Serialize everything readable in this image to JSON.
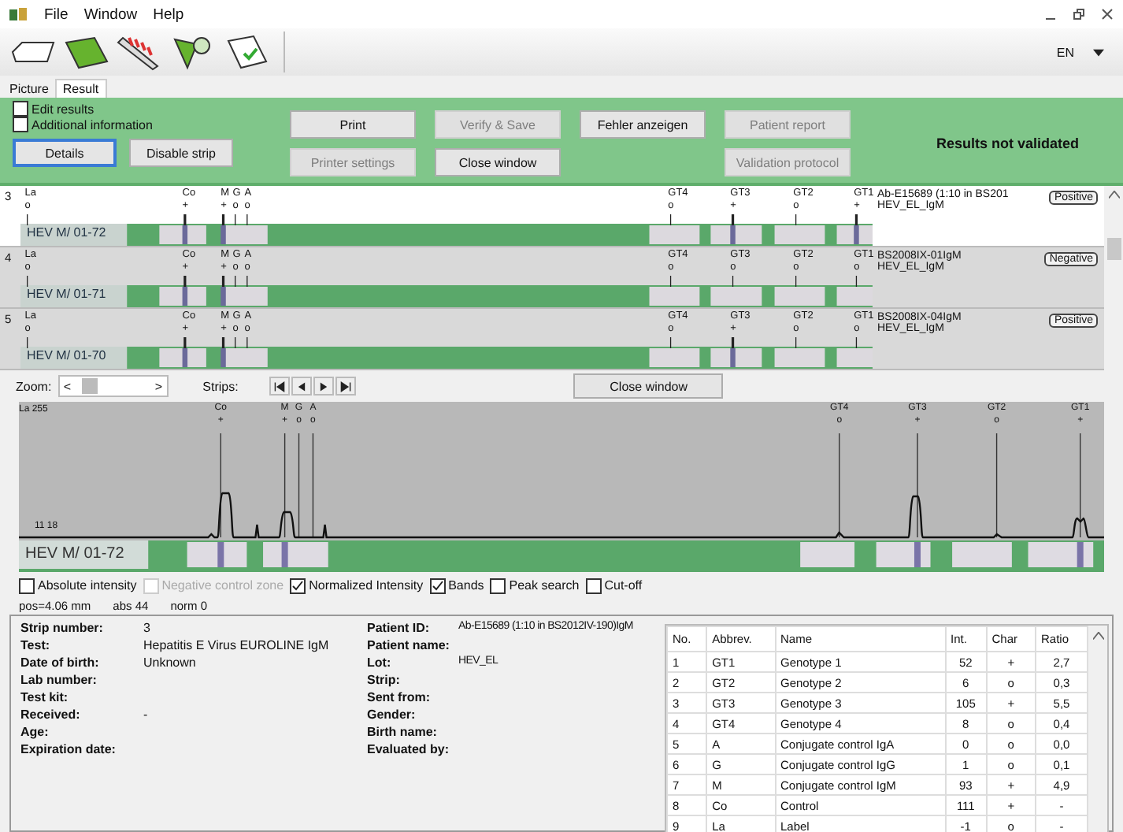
{
  "window": {
    "menu": [
      "File",
      "Window",
      "Help"
    ],
    "language": "EN"
  },
  "tabs": [
    {
      "label": "Picture",
      "selected": false
    },
    {
      "label": "Result",
      "selected": true
    }
  ],
  "options": [
    {
      "label": "Edit results",
      "checked": false
    },
    {
      "label": "Additional information",
      "checked": false
    }
  ],
  "left_buttons": [
    {
      "label": "Details",
      "disabled": false,
      "focused": true
    },
    {
      "label": "Disable strip",
      "disabled": false,
      "focused": false
    }
  ],
  "action_columns": [
    [
      {
        "label": "Print",
        "disabled": false
      },
      {
        "label": "Printer settings",
        "disabled": true
      }
    ],
    [
      {
        "label": "Verify & Save",
        "disabled": true
      },
      {
        "label": "Close window",
        "disabled": false
      }
    ],
    [
      {
        "label": "Fehler anzeigen",
        "disabled": false
      }
    ],
    [
      {
        "label": "Patient report",
        "disabled": true
      },
      {
        "label": "Validation protocol",
        "disabled": true
      }
    ]
  ],
  "validation_status": "Results not validated",
  "strips": [
    {
      "number": "3",
      "label": "HEV M/ 01-72",
      "patient": "Ab-E15689 (1:10 in BS201",
      "lot": "HEV_EL_IgM",
      "result": "Positive",
      "selected": true,
      "bands": [
        {
          "name": "La",
          "mark": "o"
        },
        {
          "name": "Co",
          "mark": "+"
        },
        {
          "name": "M",
          "mark": "+"
        },
        {
          "name": "G",
          "mark": "o"
        },
        {
          "name": "A",
          "mark": "o"
        },
        {
          "name": "GT4",
          "mark": "o"
        },
        {
          "name": "GT3",
          "mark": "+"
        },
        {
          "name": "GT2",
          "mark": "o"
        },
        {
          "name": "GT1",
          "mark": "+"
        }
      ]
    },
    {
      "number": "4",
      "label": "HEV M/ 01-71",
      "patient": "BS2008IX-01IgM",
      "lot": "HEV_EL_IgM",
      "result": "Negative",
      "selected": false,
      "bands": [
        {
          "name": "La",
          "mark": "o"
        },
        {
          "name": "Co",
          "mark": "+"
        },
        {
          "name": "M",
          "mark": "+"
        },
        {
          "name": "G",
          "mark": "o"
        },
        {
          "name": "A",
          "mark": "o"
        },
        {
          "name": "GT4",
          "mark": "o"
        },
        {
          "name": "GT3",
          "mark": "o"
        },
        {
          "name": "GT2",
          "mark": "o"
        },
        {
          "name": "GT1",
          "mark": "o"
        }
      ]
    },
    {
      "number": "5",
      "label": "HEV M/ 01-70",
      "patient": "BS2008IX-04IgM",
      "lot": "HEV_EL_IgM",
      "result": "Positive",
      "selected": false,
      "bands": [
        {
          "name": "La",
          "mark": "o"
        },
        {
          "name": "Co",
          "mark": "+"
        },
        {
          "name": "M",
          "mark": "+"
        },
        {
          "name": "G",
          "mark": "o"
        },
        {
          "name": "A",
          "mark": "o"
        },
        {
          "name": "GT4",
          "mark": "o"
        },
        {
          "name": "GT3",
          "mark": "+"
        },
        {
          "name": "GT2",
          "mark": "o"
        },
        {
          "name": "GT1",
          "mark": "o"
        }
      ]
    }
  ],
  "zoom": {
    "label": "Zoom:",
    "left": "<",
    "right": ">"
  },
  "strip_nav": {
    "label": "Strips:"
  },
  "close_window_button": "Close window",
  "graph": {
    "scale_label": "La 255",
    "baseline_label": "11 18",
    "strip_label": "HEV M/ 01-72",
    "bands": [
      {
        "name": "Co",
        "mark": "+"
      },
      {
        "name": "M",
        "mark": "+"
      },
      {
        "name": "G",
        "mark": "o"
      },
      {
        "name": "A",
        "mark": "o"
      },
      {
        "name": "GT4",
        "mark": "o"
      },
      {
        "name": "GT3",
        "mark": "+"
      },
      {
        "name": "GT2",
        "mark": "o"
      },
      {
        "name": "GT1",
        "mark": "+"
      }
    ]
  },
  "view_options": [
    {
      "label": "Absolute intensity",
      "checked": false,
      "disabled": false
    },
    {
      "label": "Negative control zone",
      "checked": false,
      "disabled": true
    },
    {
      "label": "Normalized Intensity",
      "checked": true,
      "disabled": false
    },
    {
      "label": "Bands",
      "checked": true,
      "disabled": false
    },
    {
      "label": "Peak search",
      "checked": false,
      "disabled": false
    },
    {
      "label": "Cut-off",
      "checked": false,
      "disabled": false
    }
  ],
  "readout": [
    "pos=4.06 mm",
    "abs 44",
    "norm 0"
  ],
  "details_left": [
    {
      "label": "Strip number:",
      "value": "3"
    },
    {
      "label": "Test:",
      "value": "Hepatitis E Virus EUROLINE IgM"
    },
    {
      "label": "Date of birth:",
      "value": "Unknown"
    },
    {
      "label": "Lab number:"
    },
    {
      "label": "Test kit:"
    },
    {
      "label": "Received:",
      "value": "-"
    },
    {
      "label": "Age:"
    },
    {
      "label": "Expiration date:"
    }
  ],
  "details_right": [
    {
      "label": "Patient ID:",
      "value": "Ab-E15689 (1:10 in BS2012IV-190)IgM"
    },
    {
      "label": "Patient name:"
    },
    {
      "label": "Lot:",
      "value": "HEV_EL"
    },
    {
      "label": "Strip:"
    },
    {
      "label": "Sent from:"
    },
    {
      "label": "Gender:"
    },
    {
      "label": "Birth name:"
    },
    {
      "label": "Evaluated by:"
    }
  ],
  "table": {
    "columns": [
      "No.",
      "Abbrev.",
      "Name",
      "Int.",
      "Char",
      "Ratio"
    ],
    "rows": [
      [
        "1",
        "GT1",
        "Genotype 1",
        "52",
        "+",
        "2,7"
      ],
      [
        "2",
        "GT2",
        "Genotype 2",
        "6",
        "o",
        "0,3"
      ],
      [
        "3",
        "GT3",
        "Genotype 3",
        "105",
        "+",
        "5,5"
      ],
      [
        "4",
        "GT4",
        "Genotype 4",
        "8",
        "o",
        "0,4"
      ],
      [
        "5",
        "A",
        "Conjugate control IgA",
        "0",
        "o",
        "0,0"
      ],
      [
        "6",
        "G",
        "Conjugate control IgG",
        "1",
        "o",
        "0,1"
      ],
      [
        "7",
        "M",
        "Conjugate control IgM",
        "93",
        "+",
        "4,9"
      ],
      [
        "8",
        "Co",
        "Control",
        "111",
        "+",
        "-"
      ],
      [
        "9",
        "La",
        "Label",
        "-1",
        "o",
        "-"
      ]
    ]
  }
}
